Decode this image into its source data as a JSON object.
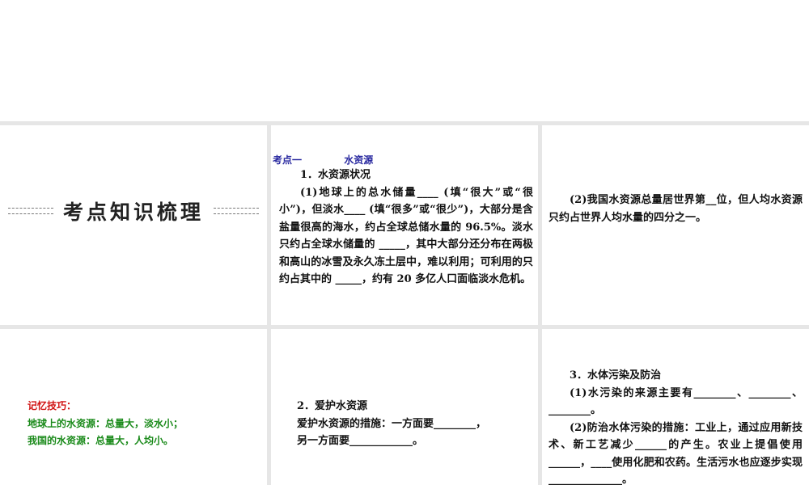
{
  "section_title": "考点知识梳理",
  "topic": {
    "label": "考点一",
    "name": "水资源"
  },
  "p2": {
    "heading": "1．水资源状况",
    "para": "(1)地球上的总水储量____ (填“很大”或“很小”)，但淡水____ (填“很多”或“很少”)，大部分是含盐量很高的海水，约占全球总储水量的 96.5%。淡水只约占全球水储量的 _____，其中大部分还分布在两极和高山的冰雪及永久冻土层中，难以利用；可利用的只约占其中的 _____，约有 20 多亿人口面临淡水危机。"
  },
  "p3": {
    "para": "(2)我国水资源总量居世界第__位，但人均水资源只约占世界人均水量的四分之一。"
  },
  "memory": {
    "label": "记忆技巧：",
    "line1": "地球上的水资源：总量大，淡水小；",
    "line2": "我国的水资源：总量大，人均小。"
  },
  "p5": {
    "heading": "2．爱护水资源",
    "line1": "爱护水资源的措施：一方面要________，",
    "line2": "另一方面要____________。"
  },
  "p6": {
    "heading": "3．水体污染及防治",
    "para1": "(1)水污染的来源主要有________、________、________。",
    "para2": "(2)防治水体污染的措施：工业上，通过应用新技术、新工艺减少______的产生。农业上提倡使用______，____使用化肥和农药。生活污水也应逐步实现______________。"
  }
}
